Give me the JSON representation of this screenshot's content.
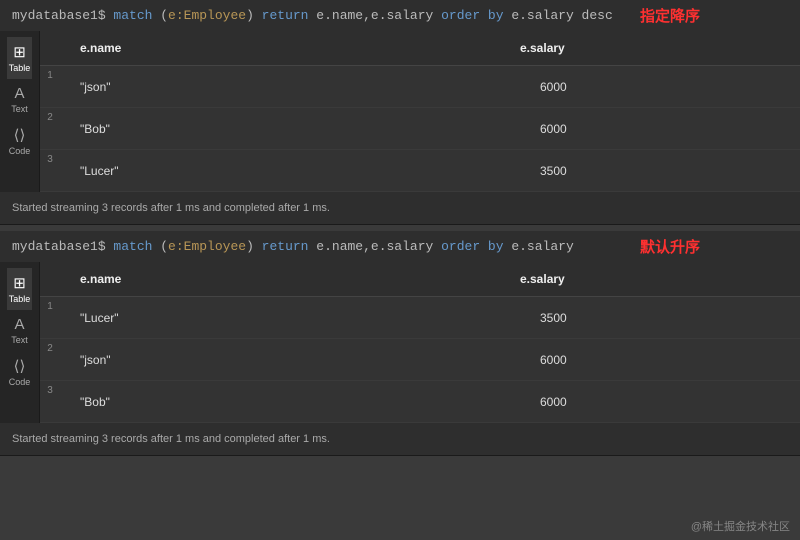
{
  "panels": [
    {
      "prompt": "mydatabase1$ ",
      "query_parts": {
        "p1": "match",
        "p2": " (",
        "p3": "e:Employee",
        "p4": ") ",
        "p5": "return",
        "p6": " e.name,e.salary ",
        "p7": "order by",
        "p8": " e.salary desc"
      },
      "annotation": "指定降序",
      "sidebar": [
        {
          "icon": "⊞",
          "label": "Table"
        },
        {
          "icon": "A",
          "label": "Text"
        },
        {
          "icon": "⟨⟩",
          "label": "Code"
        }
      ],
      "headers": {
        "name": "e.name",
        "salary": "e.salary"
      },
      "rows": [
        {
          "num": "1",
          "name": "\"json\"",
          "salary": "6000"
        },
        {
          "num": "2",
          "name": "\"Bob\"",
          "salary": "6000"
        },
        {
          "num": "3",
          "name": "\"Lucer\"",
          "salary": "3500"
        }
      ],
      "status": "Started streaming 3 records after 1 ms and completed after 1 ms."
    },
    {
      "prompt": "mydatabase1$ ",
      "query_parts": {
        "p1": "match",
        "p2": " (",
        "p3": "e:Employee",
        "p4": ") ",
        "p5": "return",
        "p6": " e.name,e.salary ",
        "p7": "order by",
        "p8": " e.salary"
      },
      "annotation": "默认升序",
      "sidebar": [
        {
          "icon": "⊞",
          "label": "Table"
        },
        {
          "icon": "A",
          "label": "Text"
        },
        {
          "icon": "⟨⟩",
          "label": "Code"
        }
      ],
      "headers": {
        "name": "e.name",
        "salary": "e.salary"
      },
      "rows": [
        {
          "num": "1",
          "name": "\"Lucer\"",
          "salary": "3500"
        },
        {
          "num": "2",
          "name": "\"json\"",
          "salary": "6000"
        },
        {
          "num": "3",
          "name": "\"Bob\"",
          "salary": "6000"
        }
      ],
      "status": "Started streaming 3 records after 1 ms and completed after 1 ms."
    }
  ],
  "watermark": "@稀土掘金技术社区"
}
